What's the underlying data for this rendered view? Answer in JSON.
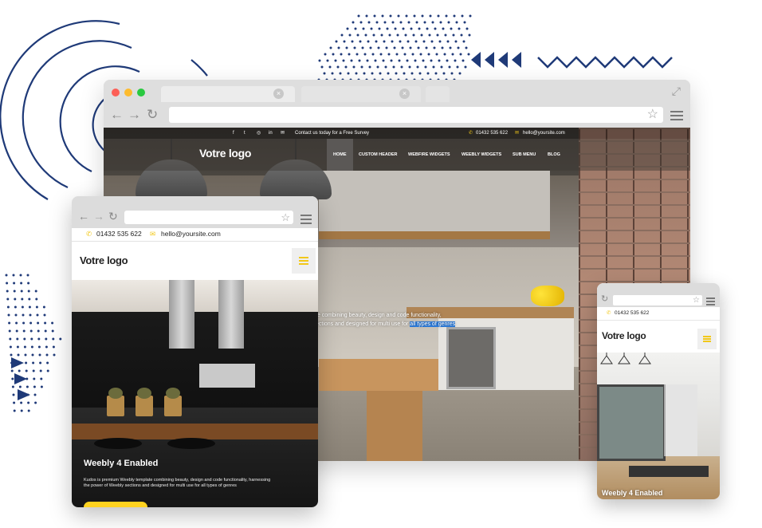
{
  "desktop": {
    "topbar": {
      "social_icons": [
        "facebook-icon",
        "twitter-icon",
        "instagram-icon",
        "linkedin-icon",
        "email-icon"
      ],
      "survey_text": "Contact us today for a Free Survey",
      "phone": "01432 535 622",
      "email": "hello@yoursite.com"
    },
    "logo": "Votre logo",
    "nav": [
      "HOME",
      "CUSTOM HEADER",
      "WEBFIRE WIDGETS",
      "WEEBLY WIDGETS",
      "SUB MENU",
      "BLOG"
    ],
    "hero": {
      "line1": "te combining beauty, design and code functionality,",
      "line2_pre": "ections and designed for multi use for ",
      "line2_highlight": "all types of genres"
    }
  },
  "tablet": {
    "phone": "01432 535 622",
    "email": "hello@yoursite.com",
    "logo": "Votre logo",
    "hero_title": "Weebly 4 Enabled",
    "hero_sub": "Kudos is premium Weebly template combining beauty, design and code functionality, harnessing the power of Weebly sections and designed for multi use for all types of genres"
  },
  "phone": {
    "phone": "01432 535 622",
    "logo": "Votre logo",
    "hero_title": "Weebly 4 Enabled"
  },
  "colors": {
    "accent_yellow": "#f2c81a",
    "deco_navy": "#1f3a78",
    "highlight_blue": "#2f7fe0"
  }
}
